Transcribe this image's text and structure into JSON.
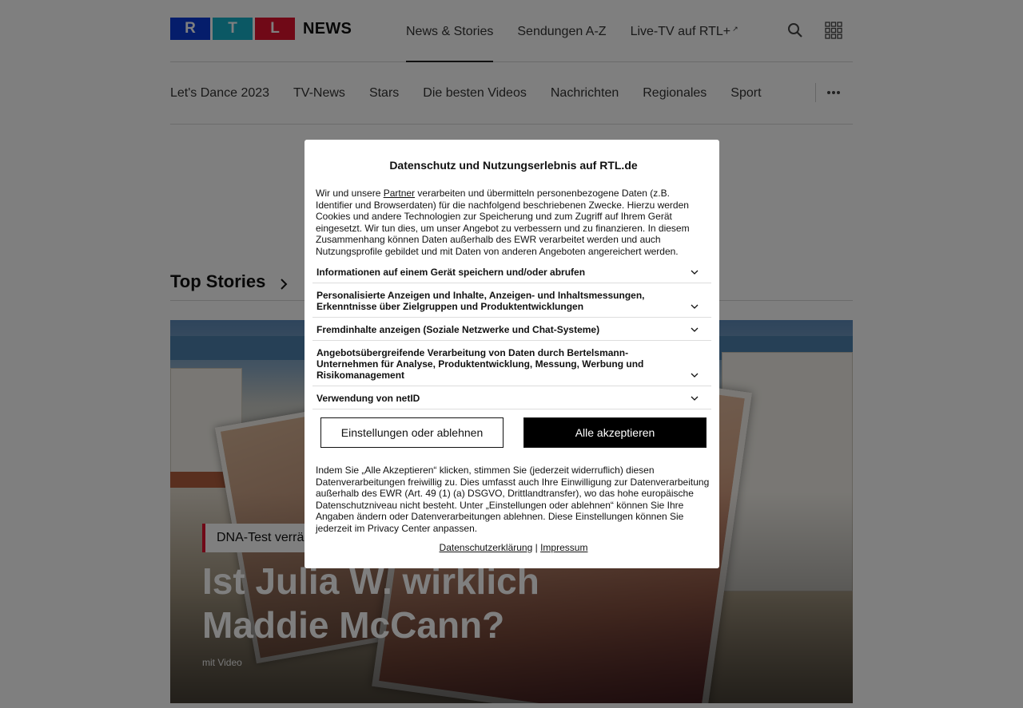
{
  "header": {
    "logo_letters": [
      "R",
      "T",
      "L"
    ],
    "logo_news": "NEWS",
    "nav": [
      {
        "label": "News & Stories"
      },
      {
        "label": "Sendungen A-Z"
      },
      {
        "label": "Live-TV auf RTL+"
      }
    ],
    "external_mark": "↗"
  },
  "subnav": {
    "items": [
      "Let's Dance 2023",
      "TV-News",
      "Stars",
      "Die besten Videos",
      "Nachrichten",
      "Regionales",
      "Sport"
    ]
  },
  "section": {
    "title": "Top Stories"
  },
  "hero": {
    "kicker": "DNA-Test verrä",
    "headline": "Ist Julia W. wirklich Maddie McCann?",
    "meta": "mit Video"
  },
  "consent": {
    "title": "Datenschutz und Nutzungserlebnis auf RTL.de",
    "intro_before": "Wir und unsere ",
    "intro_link": "Partner",
    "intro_after": " verarbeiten und übermitteln personenbezogene Daten (z.B. Identifier und Browserdaten) für die nachfolgend beschriebenen Zwecke. Hierzu werden Cookies und andere Technologien zur Speicherung und zum Zugriff auf Ihrem Gerät eingesetzt. Wir tun dies, um unser Angebot zu verbessern und zu finanzieren. In diesem Zusammenhang können Daten außerhalb des EWR verarbeitet werden und auch Nutzungsprofile gebildet und mit Daten von anderen Angeboten angereichert werden.",
    "purposes": [
      "Informationen auf einem Gerät speichern und/oder abrufen",
      "Personalisierte Anzeigen und Inhalte, Anzeigen- und Inhaltsmessungen, Erkenntnisse über Zielgruppen und Produktentwicklungen",
      "Fremdinhalte anzeigen (Soziale Netzwerke und Chat-Systeme)",
      "Angebotsübergreifende Verarbeitung von Daten durch Bertelsmann-Unternehmen für Analyse, Produktentwicklung, Messung, Werbung und Risikomanagement",
      "Verwendung von netID"
    ],
    "settings_button": "Einstellungen oder ablehnen",
    "accept_button": "Alle akzeptieren",
    "legal": "Indem Sie „Alle Akzeptieren“ klicken, stimmen Sie (jederzeit widerruflich) diesen Datenverarbeitungen freiwillig zu. Dies umfasst auch Ihre Einwilligung zur Datenverarbeitung außerhalb des EWR (Art. 49 (1) (a) DSGVO, Drittlandtransfer), wo das hohe europäische Datenschutzniveau nicht besteht. Unter „Einstellungen oder ablehnen“ können Sie Ihre Angaben ändern oder Datenverarbeitungen ablehnen. Diese Einstellungen können Sie jederzeit im Privacy Center anpassen.",
    "privacy_link": "Datenschutzerklärung",
    "separator": "|",
    "imprint_link": "Impressum"
  }
}
